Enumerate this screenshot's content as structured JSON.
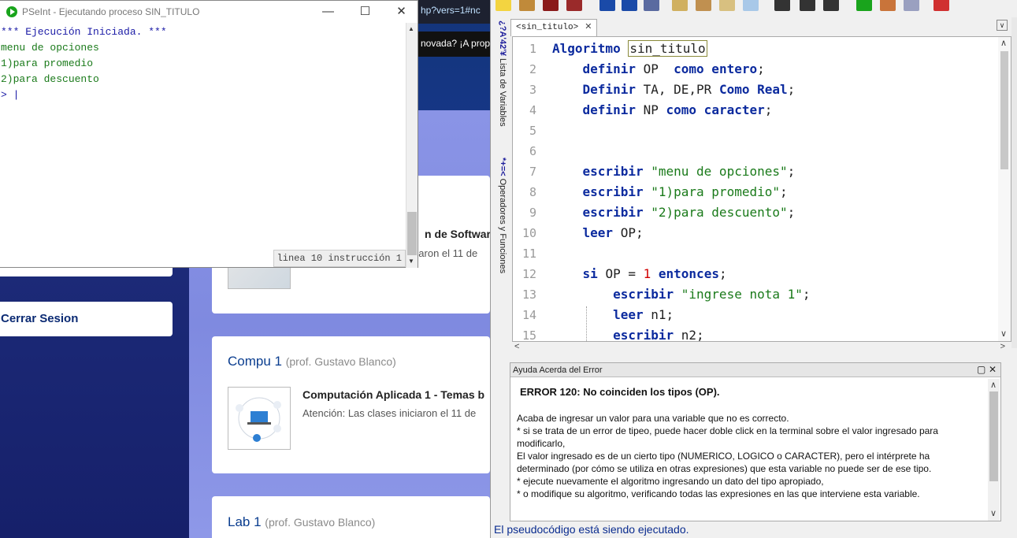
{
  "browser": {
    "url_fragment": "hp?vers=1#nc",
    "banner_text": "novada? ¡A propo"
  },
  "web": {
    "logout_label": "Cerrar Sesion",
    "courses": [
      {
        "title": "",
        "prof": "",
        "item_title": "n de Softwar",
        "item_desc": "iciaron el 11 de"
      },
      {
        "title": "Compu 1",
        "prof": "(prof. Gustavo Blanco)",
        "item_title": "Computación Aplicada 1 - Temas b",
        "item_desc": "Atención: Las clases iniciaron el 11 de"
      },
      {
        "title": "Lab 1",
        "prof": "(prof. Gustavo Blanco)"
      }
    ]
  },
  "terminal": {
    "title": "PSeInt - Ejecutando proceso SIN_TITULO",
    "lines": [
      "*** Ejecución Iniciada. ***",
      "menu de opciones",
      "1)para promedio",
      "2)para descuento",
      "> |"
    ],
    "status": "linea 10 instrucción 1"
  },
  "editor": {
    "tab_label": "<sin_titulo>",
    "side_tabs": {
      "variables_symbol": "¿?A'42'¥",
      "variables_label": "Lista de Variables",
      "operators_symbol": "*+=<",
      "operators_label": "Operadores y Funciones"
    },
    "code": {
      "l1": {
        "n": "1",
        "kw": "Algoritmo",
        "name": "sin_titulo"
      },
      "l2": {
        "n": "2",
        "kw1": "definir",
        "id": "OP",
        "kw2": "como entero",
        "end": ";"
      },
      "l3": {
        "n": "3",
        "kw1": "Definir",
        "id": "TA, DE,PR",
        "kw2": "Como Real",
        "end": ";"
      },
      "l4": {
        "n": "4",
        "kw1": "definir",
        "id": "NP",
        "kw2": "como caracter",
        "end": ";"
      },
      "l5": {
        "n": "5"
      },
      "l6": {
        "n": "6"
      },
      "l7": {
        "n": "7",
        "kw": "escribir",
        "str": "\"menu de opciones\"",
        "end": ";"
      },
      "l8": {
        "n": "8",
        "kw": "escribir",
        "str": "\"1)para promedio\"",
        "end": ";"
      },
      "l9": {
        "n": "9",
        "kw": "escribir",
        "str": "\"2)para descuento\"",
        "end": ";"
      },
      "l10": {
        "n": "10",
        "kw": "leer",
        "id": "OP",
        "end": ";"
      },
      "l11": {
        "n": "11"
      },
      "l12": {
        "n": "12",
        "kw1": "si",
        "id": "OP =",
        "num": "1",
        "kw2": "entonces",
        "end": ";"
      },
      "l13": {
        "n": "13",
        "kw": "escribir",
        "str": "\"ingrese nota 1\"",
        "end": ";"
      },
      "l14": {
        "n": "14",
        "kw": "leer",
        "id": "n1",
        "end": ";"
      },
      "l15": {
        "n": "15",
        "kw": "escribir",
        "id": "n2",
        "end": ";"
      }
    },
    "help": {
      "title": "Ayuda Acerda del Error",
      "error": "ERROR 120: No coinciden los tipos (OP).",
      "lines": [
        "Acaba de ingresar un valor para una variable que no es correcto.",
        "* si se trata de un error de tipeo, puede hacer doble click en la terminal sobre el valor ingresado para",
        "modificarlo,",
        "El valor ingresado es de un cierto tipo (NUMERICO, LOGICO o CARACTER), pero el intérprete ha",
        "determinado (por cómo se utiliza en otras expresiones) que esta variable no puede ser de ese tipo.",
        "* ejecute nuevamente el algoritmo ingresando un dato del tipo apropiado,",
        "* o modifique su algoritmo, verificando todas las expresiones en las que interviene esta variable."
      ]
    },
    "status": "El pseudocódigo está siendo ejecutado."
  }
}
